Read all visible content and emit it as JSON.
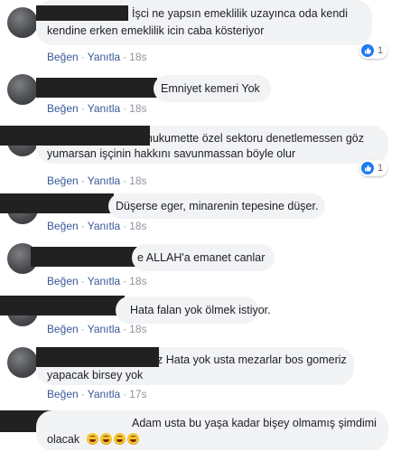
{
  "actions": {
    "like": "Beğen",
    "reply": "Yanıtla",
    "separator": "·"
  },
  "comments": [
    {
      "lines": [
        "İşci ne yapsın emeklilik uzayınca oda kendi",
        "kendine erken emeklilik icin caba kösteriyor"
      ],
      "time": "18s",
      "reaction": {
        "icon": "like-icon",
        "count": "1"
      }
    },
    {
      "lines": [
        "Emniyet kemeri Yok"
      ],
      "time": "18s"
    },
    {
      "lines": [
        "Hata hukumette özel sektoru denetlemessen göz",
        "yumarsan işçinin hakkını savunmassan böyle olur"
      ],
      "time": "18s",
      "reaction": {
        "icon": "like-icon",
        "count": "1"
      }
    },
    {
      "lines": [
        "Düşerse eger, minarenin tepesine düşer."
      ],
      "time": "18s"
    },
    {
      "lines": [
        "e ALLAH'a emanet canlar"
      ],
      "time": "18s"
    },
    {
      "lines": [
        "Hata falan yok ölmek istiyor."
      ],
      "time": "18s"
    },
    {
      "lines": [
        "z Hata yok usta mezarlar bos gomeriz",
        "yapacak birsey yok"
      ],
      "time": "17s"
    },
    {
      "lines": [
        "Adam usta bu yaşa kadar bişey olmamış şimdimi",
        "olacak"
      ],
      "emojis": [
        "grinning-face-with-sweat-icon",
        "grinning-face-with-sweat-icon",
        "grinning-face-with-sweat-icon",
        "grinning-face-with-sweat-icon"
      ]
    }
  ]
}
